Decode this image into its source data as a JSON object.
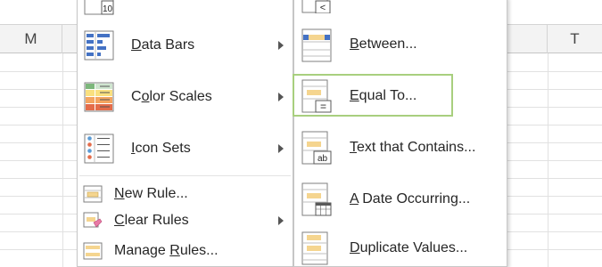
{
  "grid": {
    "columns": [
      {
        "label": "M"
      },
      {
        "label": ""
      },
      {
        "label": "T"
      }
    ]
  },
  "main_menu": {
    "items": [
      {
        "pre": "",
        "u": "D",
        "post": "ata Bars",
        "has_submenu": true,
        "icon": "data-bars-icon"
      },
      {
        "pre": "C",
        "u": "o",
        "post": "lor Scales",
        "has_submenu": true,
        "icon": "color-scales-icon"
      },
      {
        "pre": "",
        "u": "I",
        "post": "con Sets",
        "has_submenu": true,
        "icon": "icon-sets-icon"
      },
      {
        "pre": "",
        "u": "N",
        "post": "ew Rule...",
        "has_submenu": false,
        "icon": "new-rule-icon"
      },
      {
        "pre": "",
        "u": "C",
        "post": "lear Rules",
        "has_submenu": true,
        "icon": "clear-rules-icon"
      },
      {
        "pre": "Manage ",
        "u": "R",
        "post": "ules...",
        "has_submenu": false,
        "icon": "manage-rules-icon"
      }
    ]
  },
  "sub_menu": {
    "items": [
      {
        "pre": "",
        "u": "B",
        "post": "etween...",
        "icon": "between-icon",
        "highlighted": false
      },
      {
        "pre": "",
        "u": "E",
        "post": "qual To...",
        "icon": "equal-to-icon",
        "highlighted": true
      },
      {
        "pre": "",
        "u": "T",
        "post": "ext that Contains...",
        "icon": "text-contains-icon",
        "highlighted": false
      },
      {
        "pre": "",
        "u": "A",
        "post": " Date Occurring...",
        "icon": "date-occurring-icon",
        "highlighted": false
      },
      {
        "pre": "",
        "u": "D",
        "post": "uplicate Values...",
        "icon": "duplicate-values-icon",
        "highlighted": false
      }
    ],
    "partial_top_icon_glyph": "<",
    "equal_glyph": "=",
    "text_glyph": "ab"
  },
  "partial_top_main_icon_text": "10",
  "colors": {
    "highlight_border": "#a8cf7e",
    "bar_blue": "#4472c4",
    "cell_fill": "#f5d58f",
    "scale_red": "#e46c4a",
    "scale_orange": "#f4a460",
    "scale_yellow": "#f9e07f",
    "scale_green": "#7cb77b"
  }
}
